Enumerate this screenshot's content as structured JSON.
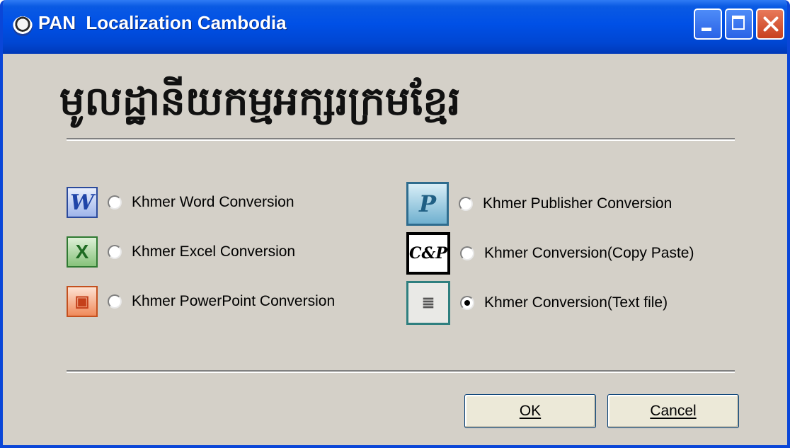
{
  "window": {
    "title": "PAN  Localization Cambodia",
    "heading": "មូលដ្ឋានីយកម្មអក្សរក្រមខ្មែរ"
  },
  "options": [
    {
      "label": "Khmer Word Conversion",
      "icon": "word-icon",
      "glyph": "W",
      "selected": false
    },
    {
      "label": "Khmer Excel Conversion",
      "icon": "excel-icon",
      "glyph": "X",
      "selected": false
    },
    {
      "label": "Khmer PowerPoint Conversion",
      "icon": "powerpoint-icon",
      "glyph": "▣",
      "selected": false
    },
    {
      "label": "Khmer Publisher Conversion",
      "icon": "publisher-icon",
      "glyph": "P",
      "selected": false
    },
    {
      "label": "Khmer Conversion(Copy Paste)",
      "icon": "copy-paste-icon",
      "glyph": "C&P",
      "selected": false
    },
    {
      "label": "Khmer Conversion(Text file)",
      "icon": "text-file-icon",
      "glyph": "≣",
      "selected": true
    }
  ],
  "buttons": {
    "ok": "OK",
    "cancel": "Cancel"
  },
  "colors": {
    "titlebar": "#0050e6",
    "dialog_bg": "#d4d0c8"
  }
}
